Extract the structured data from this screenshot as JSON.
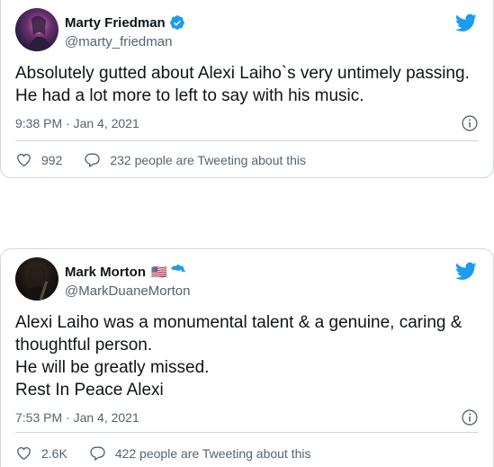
{
  "colors": {
    "twitter_blue": "#1d9bf0",
    "text_primary": "#0f1419",
    "text_secondary": "#536471",
    "border": "#cfd9de"
  },
  "tweets": [
    {
      "display_name": "Marty Friedman",
      "handle": "@marty_friedman",
      "flag": "",
      "verified_icon": "verified-badge-icon",
      "text": "Absolutely gutted about Alexi Laiho`s very untimely passing.\nHe had a lot more to left to say with his music.",
      "timestamp": "9:38 PM · Jan 4, 2021",
      "likes": "992",
      "replies_text": "232 people are Tweeting about this"
    },
    {
      "display_name": "Mark Morton",
      "handle": "@MarkDuaneMorton",
      "flag": "🇺🇸",
      "verified_icon": "verified-badge-icon",
      "text": "Alexi Laiho was a monumental talent & a genuine, caring &\nthoughtful person.\nHe will be greatly missed.\nRest In Peace Alexi",
      "timestamp": "7:53 PM · Jan 4, 2021",
      "likes": "2.6K",
      "replies_text": "422 people are Tweeting about this"
    }
  ]
}
